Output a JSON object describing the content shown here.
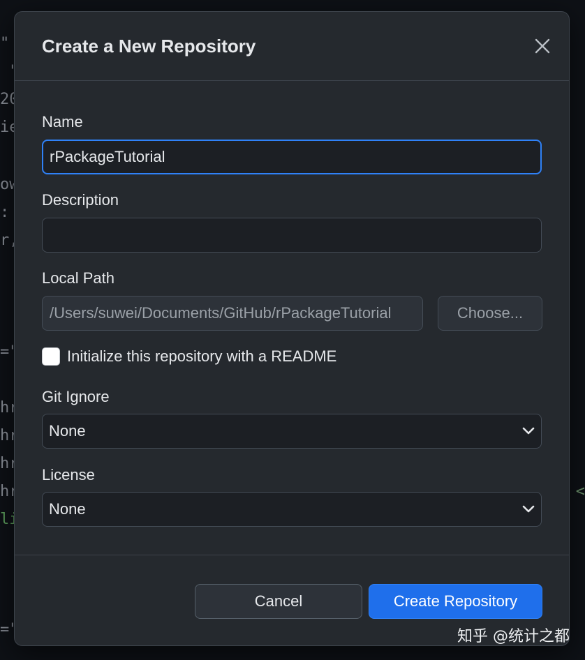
{
  "dialog": {
    "title": "Create a New Repository",
    "close_icon": "close-icon"
  },
  "form": {
    "name_label": "Name",
    "name_value": "rPackageTutorial",
    "description_label": "Description",
    "description_value": "",
    "local_path_label": "Local Path",
    "local_path_value": "/Users/suwei/Documents/GitHub/rPackageTutorial",
    "choose_label": "Choose...",
    "readme_label": "Initialize this repository with a README",
    "readme_checked": false,
    "gitignore_label": "Git Ignore",
    "gitignore_value": "None",
    "license_label": "License",
    "license_value": "None"
  },
  "footer": {
    "cancel_label": "Cancel",
    "create_label": "Create Repository"
  },
  "watermark": "知乎 @统计之都",
  "colors": {
    "accent": "#1f6feb",
    "focus_border": "#2f81f7",
    "dialog_bg": "#25292e"
  }
}
